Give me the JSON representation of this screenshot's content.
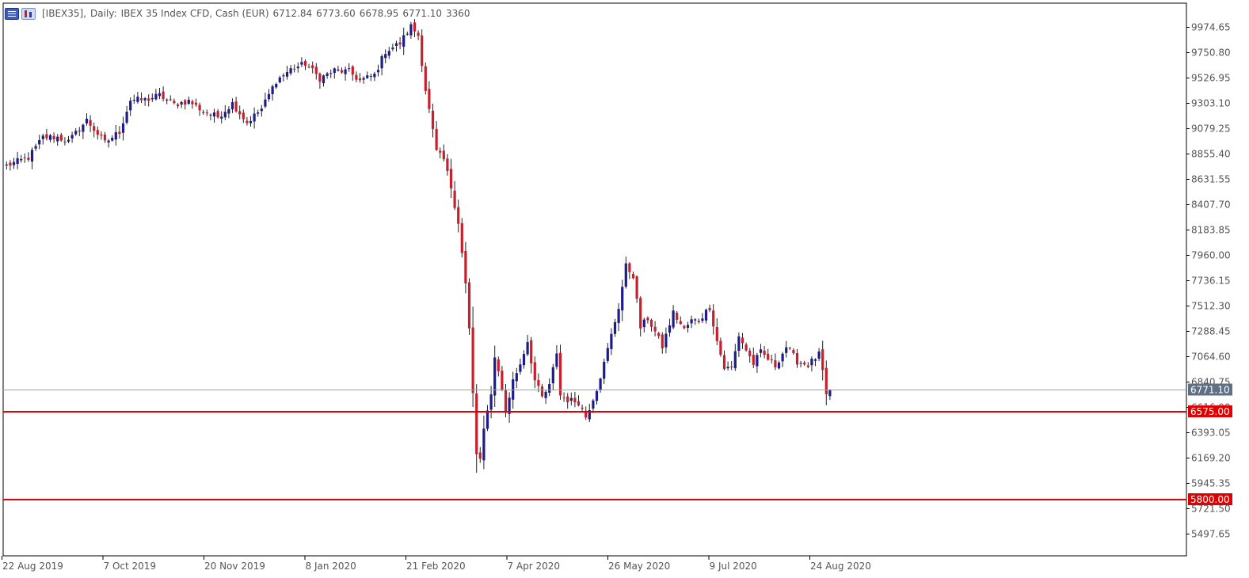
{
  "header": {
    "symbol": "[IBEX35],",
    "timeframe": "Daily:",
    "description": "IBEX 35 Index CFD, Cash (EUR)",
    "open": "6712.84",
    "high": "6773.60",
    "low": "6678.95",
    "close": "6771.10",
    "volume": "3360"
  },
  "icons": [
    "chart-window-icon",
    "chart-properties-icon"
  ],
  "colors": {
    "bull": "#1c1c8c",
    "bear": "#c8202a",
    "wick": "#222222",
    "level_line": "#e00000",
    "price_line": "#a0a0a0",
    "price_tag": "#5f6f84",
    "level_tag": "#e00000",
    "frame": "#000000",
    "text": "#555555"
  },
  "chart_data": {
    "type": "candlestick",
    "title": "[IBEX35], Daily: IBEX 35 Index CFD, Cash (EUR)",
    "ylim": [
      5385.73,
      10098.42
    ],
    "y_ticks": [
      "9974.65",
      "9750.80",
      "9526.95",
      "9303.10",
      "9079.25",
      "8855.40",
      "8631.55",
      "8407.70",
      "8183.85",
      "7960.00",
      "7736.15",
      "7512.30",
      "7288.45",
      "7064.60",
      "6840.75",
      "6616.90",
      "6393.05",
      "6169.20",
      "5945.35",
      "5721.50",
      "5497.65"
    ],
    "x_ticks": [
      "22 Aug 2019",
      "7 Oct 2019",
      "20 Nov 2019",
      "8 Jan 2020",
      "21 Feb 2020",
      "7 Apr 2020",
      "26 May 2020",
      "9 Jul 2020",
      "24 Aug 2020"
    ],
    "current_price": {
      "label": "6771.10",
      "value": 6771.1
    },
    "levels": [
      {
        "label": "6575.00",
        "value": 6575.0
      },
      {
        "label": "5800.00",
        "value": 5800.0
      }
    ],
    "anchors": [
      [
        0,
        8750
      ],
      [
        6,
        8820
      ],
      [
        10,
        9000
      ],
      [
        14,
        9000
      ],
      [
        17,
        8960
      ],
      [
        22,
        9150
      ],
      [
        27,
        8950
      ],
      [
        31,
        9050
      ],
      [
        34,
        9330
      ],
      [
        38,
        9330
      ],
      [
        42,
        9370
      ],
      [
        46,
        9290
      ],
      [
        50,
        9320
      ],
      [
        54,
        9230
      ],
      [
        58,
        9180
      ],
      [
        62,
        9300
      ],
      [
        66,
        9130
      ],
      [
        70,
        9250
      ],
      [
        74,
        9500
      ],
      [
        78,
        9600
      ],
      [
        82,
        9650
      ],
      [
        86,
        9520
      ],
      [
        90,
        9590
      ],
      [
        94,
        9580
      ],
      [
        97,
        9500
      ],
      [
        101,
        9550
      ],
      [
        104,
        9760
      ],
      [
        108,
        9830
      ],
      [
        111,
        9980
      ],
      [
        113,
        9900
      ],
      [
        115,
        9420
      ],
      [
        118,
        8870
      ],
      [
        120,
        8800
      ],
      [
        122,
        8560
      ],
      [
        124,
        8250
      ],
      [
        126,
        7700
      ],
      [
        127,
        7300
      ],
      [
        128,
        6730
      ],
      [
        129,
        6200
      ],
      [
        130,
        6150
      ],
      [
        131,
        6400
      ],
      [
        133,
        6750
      ],
      [
        134,
        7050
      ],
      [
        135,
        6950
      ],
      [
        137,
        6570
      ],
      [
        139,
        6850
      ],
      [
        141,
        7000
      ],
      [
        143,
        7200
      ],
      [
        145,
        6850
      ],
      [
        147,
        6700
      ],
      [
        149,
        6800
      ],
      [
        151,
        7100
      ],
      [
        152,
        6720
      ],
      [
        154,
        6680
      ],
      [
        157,
        6660
      ],
      [
        159,
        6530
      ],
      [
        162,
        6780
      ],
      [
        164,
        7000
      ],
      [
        166,
        7250
      ],
      [
        168,
        7500
      ],
      [
        170,
        7860
      ],
      [
        172,
        7780
      ],
      [
        174,
        7320
      ],
      [
        176,
        7400
      ],
      [
        178,
        7280
      ],
      [
        180,
        7150
      ],
      [
        183,
        7450
      ],
      [
        186,
        7300
      ],
      [
        188,
        7380
      ],
      [
        190,
        7380
      ],
      [
        193,
        7500
      ],
      [
        195,
        7200
      ],
      [
        197,
        6960
      ],
      [
        199,
        6960
      ],
      [
        201,
        7250
      ],
      [
        203,
        7120
      ],
      [
        205,
        7000
      ],
      [
        207,
        7100
      ],
      [
        211,
        6980
      ],
      [
        214,
        7150
      ],
      [
        217,
        7020
      ],
      [
        220,
        6990
      ],
      [
        223,
        7080
      ],
      [
        224,
        6930
      ],
      [
        225,
        6700
      ],
      [
        226,
        6780
      ]
    ]
  }
}
